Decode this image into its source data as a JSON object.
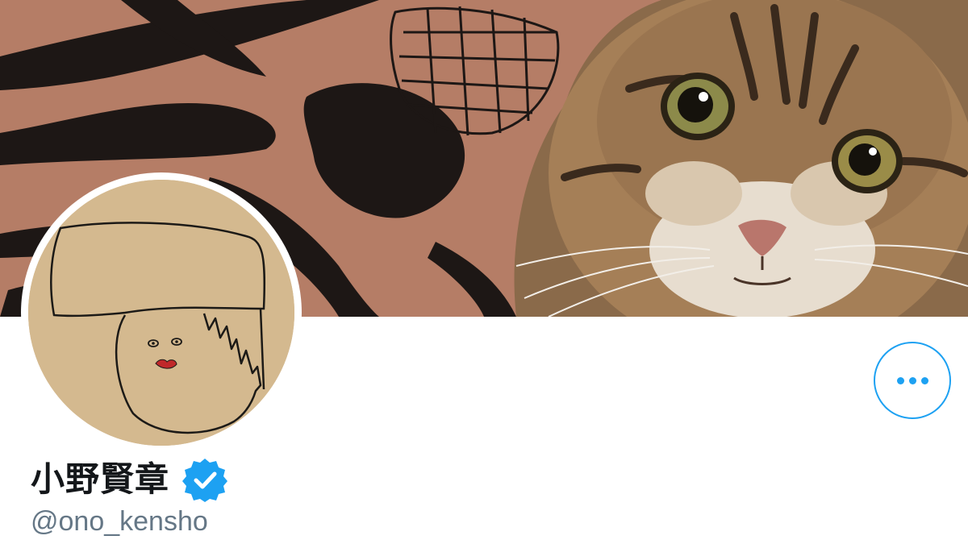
{
  "profile": {
    "display_name": "小野賢章",
    "handle": "@ono_kensho",
    "verified": true
  },
  "header_image": {
    "description_icon": "banner-image"
  },
  "avatar": {
    "icon": "avatar-image"
  },
  "actions": {
    "more_icon": "more-options-icon"
  },
  "colors": {
    "accent": "#1da1f2",
    "name_text": "#14171a",
    "handle_text": "#657786",
    "background": "#ffffff"
  }
}
